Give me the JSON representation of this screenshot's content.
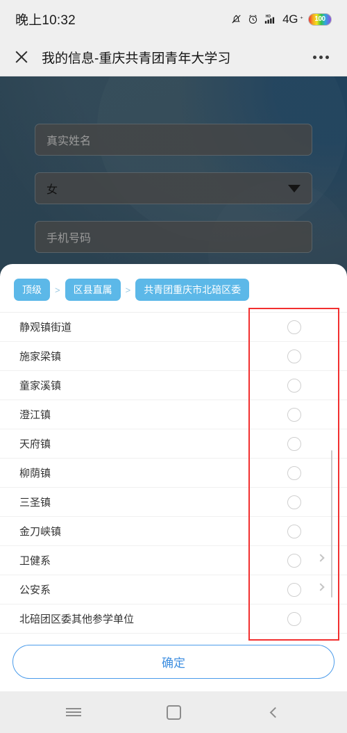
{
  "status_bar": {
    "time": "晚上10:32",
    "icons": [
      "bell-mute-icon",
      "alarm-icon",
      "signal-hd-icon"
    ],
    "network": "4G",
    "network_suffix": "⁺",
    "battery_level": "100"
  },
  "title_bar": {
    "close_icon": "close-icon",
    "title": "我的信息-重庆共青团青年大学习",
    "more_icon": "more-options-icon"
  },
  "form": {
    "name_placeholder": "真实姓名",
    "gender_value": "女",
    "phone_placeholder": "手机号码"
  },
  "picker": {
    "breadcrumb": [
      {
        "label": "顶级"
      },
      {
        "label": "区县直属"
      },
      {
        "label": "共青团重庆市北碚区委"
      }
    ],
    "separator": ">",
    "rows": [
      {
        "label": "静观镇街道",
        "has_chevron": false
      },
      {
        "label": "施家梁镇",
        "has_chevron": false
      },
      {
        "label": "童家溪镇",
        "has_chevron": false
      },
      {
        "label": "澄江镇",
        "has_chevron": false
      },
      {
        "label": "天府镇",
        "has_chevron": false
      },
      {
        "label": "柳荫镇",
        "has_chevron": false
      },
      {
        "label": "三圣镇",
        "has_chevron": false
      },
      {
        "label": "金刀峡镇",
        "has_chevron": false
      },
      {
        "label": "卫健系",
        "has_chevron": true
      },
      {
        "label": "公安系",
        "has_chevron": true
      },
      {
        "label": "北碚团区委其他参学单位",
        "has_chevron": false
      }
    ],
    "confirm_label": "确定"
  },
  "annotation": {
    "color": "#f22f2f",
    "shape": "rectangle-highlight"
  },
  "nav_bar": {
    "recents_icon": "recents-icon",
    "home_icon": "home-icon",
    "back_icon": "back-icon"
  }
}
